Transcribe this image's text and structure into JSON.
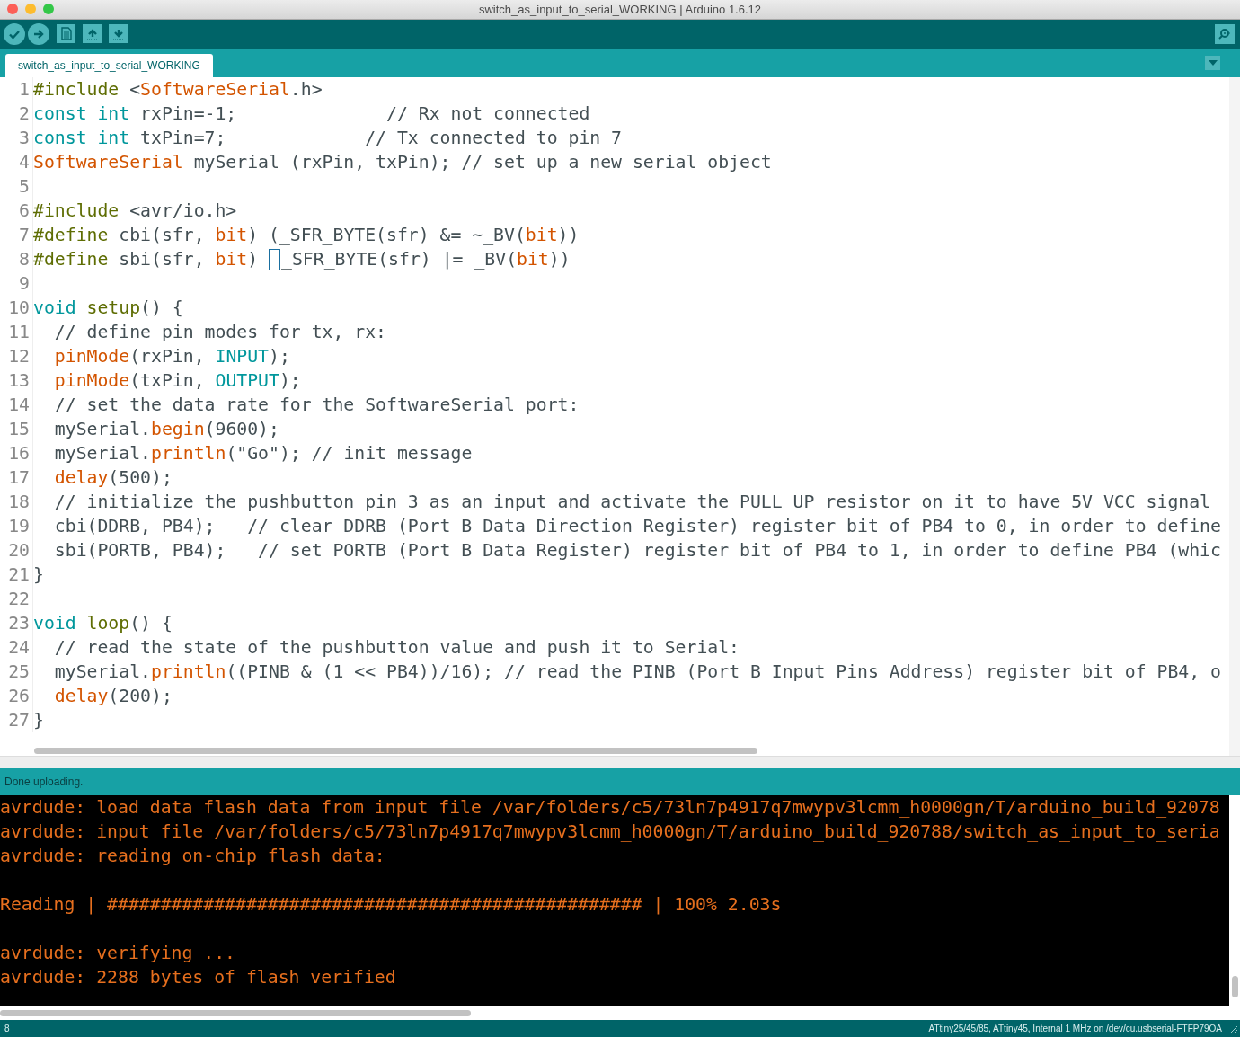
{
  "window": {
    "title": "switch_as_input_to_serial_WORKING | Arduino 1.6.12"
  },
  "tabs": [
    {
      "label": "switch_as_input_to_serial_WORKING",
      "selected": true
    }
  ],
  "editor": {
    "lines": [
      {
        "number": "1",
        "tokens": [
          {
            "kind": "structure",
            "text": "#include"
          },
          {
            "kind": "text",
            "text": " <"
          },
          {
            "kind": "function",
            "text": "SoftwareSerial"
          },
          {
            "kind": "text",
            "text": ".h>"
          }
        ]
      },
      {
        "number": "2",
        "tokens": [
          {
            "kind": "keyword",
            "text": "const int"
          },
          {
            "kind": "text",
            "text": " rxPin=-1;              // Rx not connected"
          }
        ]
      },
      {
        "number": "3",
        "tokens": [
          {
            "kind": "keyword",
            "text": "const int"
          },
          {
            "kind": "text",
            "text": " txPin=7;             // Tx connected to pin 7"
          }
        ]
      },
      {
        "number": "4",
        "tokens": [
          {
            "kind": "function",
            "text": "SoftwareSerial"
          },
          {
            "kind": "text",
            "text": " mySerial (rxPin, txPin); // set up a new serial object"
          }
        ]
      },
      {
        "number": "5"
      },
      {
        "number": "6",
        "tokens": [
          {
            "kind": "structure",
            "text": "#include"
          },
          {
            "kind": "text",
            "text": " <avr/io.h>"
          }
        ]
      },
      {
        "number": "7",
        "tokens": [
          {
            "kind": "structure",
            "text": "#define"
          },
          {
            "kind": "text",
            "text": " cbi(sfr, "
          },
          {
            "kind": "function",
            "text": "bit"
          },
          {
            "kind": "text",
            "text": ") (_SFR_BYTE(sfr) &= ~_BV("
          },
          {
            "kind": "function",
            "text": "bit"
          },
          {
            "kind": "text",
            "text": "))"
          }
        ]
      },
      {
        "number": "8",
        "tokens": [
          {
            "kind": "structure",
            "text": "#define"
          },
          {
            "kind": "text",
            "text": " sbi(sfr, "
          },
          {
            "kind": "function",
            "text": "bit"
          },
          {
            "kind": "text",
            "text": ") "
          },
          {
            "kind": "bracket-box"
          },
          {
            "kind": "text",
            "text": "_SFR_BYTE(sfr) |= _BV("
          },
          {
            "kind": "function",
            "text": "bit"
          },
          {
            "kind": "text",
            "text": "))"
          }
        ]
      },
      {
        "number": "9"
      },
      {
        "number": "10",
        "tokens": [
          {
            "kind": "keyword",
            "text": "void "
          },
          {
            "kind": "structure",
            "text": "setup"
          },
          {
            "kind": "text",
            "text": "() {"
          }
        ]
      },
      {
        "number": "11",
        "tokens": [
          {
            "kind": "text",
            "text": "  // define pin modes for tx, rx:"
          }
        ]
      },
      {
        "number": "12",
        "indented": true,
        "tokens": [
          {
            "kind": "function",
            "text": "pinMode"
          },
          {
            "kind": "text",
            "text": "(rxPin, "
          },
          {
            "kind": "keyword",
            "text": "INPUT"
          },
          {
            "kind": "text",
            "text": ");"
          }
        ]
      },
      {
        "number": "13",
        "indented": true,
        "tokens": [
          {
            "kind": "function",
            "text": "pinMode"
          },
          {
            "kind": "text",
            "text": "(txPin, "
          },
          {
            "kind": "keyword",
            "text": "OUTPUT"
          },
          {
            "kind": "text",
            "text": ");"
          }
        ]
      },
      {
        "number": "14",
        "tokens": [
          {
            "kind": "text",
            "text": "  // set the data rate for the SoftwareSerial port:"
          }
        ]
      },
      {
        "number": "15",
        "tokens": [
          {
            "kind": "text",
            "text": "  mySerial."
          },
          {
            "kind": "function",
            "text": "begin"
          },
          {
            "kind": "text",
            "text": "(9600);"
          }
        ]
      },
      {
        "number": "16",
        "tokens": [
          {
            "kind": "text",
            "text": "  mySerial."
          },
          {
            "kind": "function",
            "text": "println"
          },
          {
            "kind": "text",
            "text": "(\"Go\"); // init message"
          }
        ]
      },
      {
        "number": "17",
        "indented": true,
        "tokens": [
          {
            "kind": "function",
            "text": "delay"
          },
          {
            "kind": "text",
            "text": "(500);"
          }
        ]
      },
      {
        "number": "18",
        "tokens": [
          {
            "kind": "text",
            "text": "  // initialize the pushbutton pin 3 as an input and activate the PULL UP resistor on it to have 5V VCC signal"
          }
        ]
      },
      {
        "number": "19",
        "tokens": [
          {
            "kind": "text",
            "text": "  cbi(DDRB, PB4);   // clear DDRB (Port B Data Direction Register) register bit of PB4 to 0, in order to define"
          }
        ]
      },
      {
        "number": "20",
        "tokens": [
          {
            "kind": "text",
            "text": "  sbi(PORTB, PB4);   // set PORTB (Port B Data Register) register bit of PB4 to 1, in order to define PB4 (whic"
          }
        ]
      },
      {
        "number": "21",
        "tokens": [
          {
            "kind": "text",
            "text": "}"
          }
        ]
      },
      {
        "number": "22"
      },
      {
        "number": "23",
        "tokens": [
          {
            "kind": "keyword",
            "text": "void "
          },
          {
            "kind": "structure",
            "text": "loop"
          },
          {
            "kind": "text",
            "text": "() {"
          }
        ]
      },
      {
        "number": "24",
        "tokens": [
          {
            "kind": "text",
            "text": "  // read the state of the pushbutton value and push it to Serial:"
          }
        ]
      },
      {
        "number": "25",
        "tokens": [
          {
            "kind": "text",
            "text": "  mySerial."
          },
          {
            "kind": "function",
            "text": "println"
          },
          {
            "kind": "text",
            "text": "((PINB & (1 << PB4))/16); // read the PINB (Port B Input Pins Address) register bit of PB4, o"
          }
        ]
      },
      {
        "number": "26",
        "indented": true,
        "tokens": [
          {
            "kind": "function",
            "text": "delay"
          },
          {
            "kind": "text",
            "text": "(200);"
          }
        ]
      },
      {
        "number": "27",
        "tokens": [
          {
            "kind": "text",
            "text": "}"
          }
        ]
      }
    ]
  },
  "message": "Done uploading.",
  "console": {
    "lines": [
      {
        "text": "avrdude: load data flash data from input file /var/folders/c5/73ln7p4917q7mwypv3lcmm_h0000gn/T/arduino_build_92078"
      },
      {
        "text": "avrdude: input file /var/folders/c5/73ln7p4917q7mwypv3lcmm_h0000gn/T/arduino_build_920788/switch_as_input_to_seria"
      },
      {
        "text": "avrdude: reading on-chip flash data:"
      },
      {
        "text": "Reading | ################################################## | 100% 2.03s",
        "gap_before": true
      },
      {
        "text": "avrdude: verifying ...",
        "gap_before": true
      },
      {
        "text": "avrdude: 2288 bytes of flash verified"
      }
    ]
  },
  "status_bar": {
    "line": "8",
    "board": "ATtiny25/45/85, ATtiny45, Internal 1 MHz on /dev/cu.usbserial-FTFP79OA"
  }
}
